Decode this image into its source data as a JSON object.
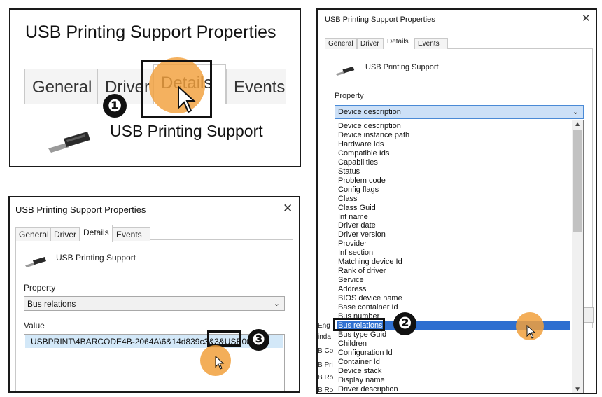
{
  "dialog_title": "USB Printing Support Properties",
  "device_name": "USB Printing Support",
  "close_symbol": "✕",
  "tabs": [
    "General",
    "Driver",
    "Details",
    "Events"
  ],
  "selected_tab": "Details",
  "property_label": "Property",
  "value_label": "Value",
  "panel2": {
    "property_selected": "Device description",
    "property_options": [
      "Device description",
      "Device instance path",
      "Hardware Ids",
      "Compatible Ids",
      "Capabilities",
      "Status",
      "Problem code",
      "Config flags",
      "Class",
      "Class Guid",
      "Inf name",
      "Driver date",
      "Driver version",
      "Provider",
      "Inf section",
      "Matching device Id",
      "Rank of driver",
      "Service",
      "Address",
      "BIOS device name",
      "Base container Id",
      "Bus number",
      "Bus relations",
      "Bus type Guid",
      "Children",
      "Configuration Id",
      "Container Id",
      "Device stack",
      "Display name",
      "Driver description"
    ],
    "highlighted_option": "Bus relations",
    "background_fragments": [
      "Eng",
      "inda",
      "B Co",
      "B Pri",
      "B Ro",
      "B Ro"
    ]
  },
  "panel3": {
    "property_selected": "Bus relations",
    "value": "USBPRINT\\4BARCODE4B-2064A\\6&14d839c3&3&USB001"
  },
  "step_badges": [
    "❶",
    "❷",
    "❸"
  ],
  "colors": {
    "click_highlight": "#F1A03C",
    "list_selection": "#2E6FD0",
    "value_selection": "#D3E8F8"
  },
  "icons": [
    "usb-connector-icon",
    "close-icon",
    "chevron-down-icon",
    "mouse-pointer-icon"
  ]
}
